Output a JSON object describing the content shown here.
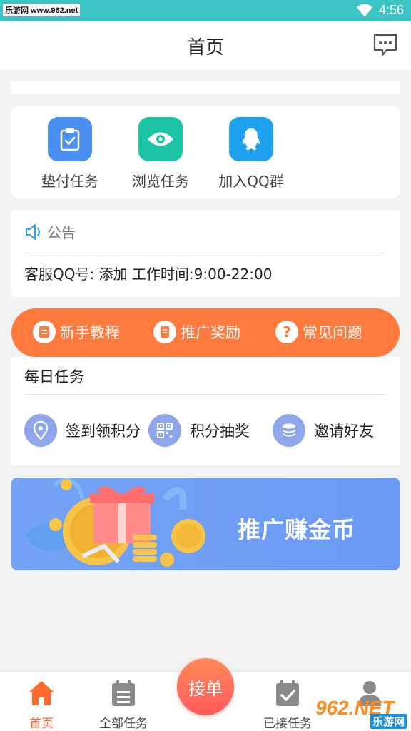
{
  "status_bar": {
    "watermark": "乐游网 www.962.net",
    "time": "4:56"
  },
  "header": {
    "title": "首页",
    "message_icon": "message-icon"
  },
  "quick_actions": [
    {
      "label": "垫付任务",
      "icon": "clipboard-icon",
      "color": "#4b8ff0"
    },
    {
      "label": "浏览任务",
      "icon": "eye-icon",
      "color": "#1dc4a6"
    },
    {
      "label": "加入QQ群",
      "icon": "qq-icon",
      "color": "#1ea2f0"
    }
  ],
  "notice": {
    "heading": "公告",
    "text": "客服QQ号: 添加  工作时间:9:00-22:00"
  },
  "orange_tabs": [
    {
      "label": "新手教程",
      "icon": "document-icon"
    },
    {
      "label": "推广奖励",
      "icon": "receipt-icon"
    },
    {
      "label": "常见问题",
      "icon": "question-icon"
    }
  ],
  "daily": {
    "title": "每日任务",
    "items": [
      {
        "label": "签到领积分",
        "icon": "location-pin-icon"
      },
      {
        "label": "积分抽奖",
        "icon": "qr-grid-icon"
      },
      {
        "label": "邀请好友",
        "icon": "coin-stack-icon"
      }
    ]
  },
  "banner": {
    "text": "推广赚金币"
  },
  "bottom_nav": {
    "items": [
      {
        "label": "首页",
        "icon": "home-icon",
        "active": true
      },
      {
        "label": "全部任务",
        "icon": "calendar-list-icon"
      },
      {
        "label": "已接任务",
        "icon": "calendar-check-icon"
      },
      {
        "label": "",
        "icon": "user-icon"
      }
    ],
    "center_label": "接单"
  },
  "corner_watermark": {
    "brand": "962.NET",
    "sub": "乐游网"
  },
  "colors": {
    "status_bar": "#3cc3c5",
    "orange": "#ff7a3d",
    "active_nav": "#ff6a2f",
    "banner": "#6a9af4"
  }
}
